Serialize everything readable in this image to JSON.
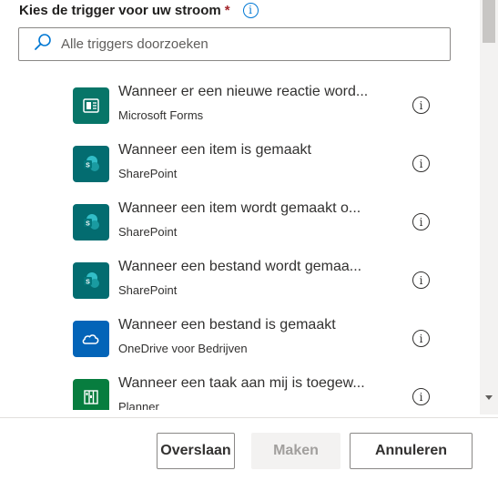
{
  "header": {
    "title": "Kies de trigger voor uw stroom",
    "required_mark": "*",
    "info_glyph": "i"
  },
  "search": {
    "placeholder": "Alle triggers doorzoeken"
  },
  "triggers": [
    {
      "title": "Wanneer er een nieuwe reactie word...",
      "connector": "Microsoft Forms",
      "icon": "forms-icon",
      "color": "#077568"
    },
    {
      "title": "Wanneer een item is gemaakt",
      "connector": "SharePoint",
      "icon": "sharepoint-icon",
      "color": "#036c70"
    },
    {
      "title": "Wanneer een item wordt gemaakt o...",
      "connector": "SharePoint",
      "icon": "sharepoint-icon",
      "color": "#036c70"
    },
    {
      "title": "Wanneer een bestand wordt gemaa...",
      "connector": "SharePoint",
      "icon": "sharepoint-icon",
      "color": "#036c70"
    },
    {
      "title": "Wanneer een bestand is gemaakt",
      "connector": "OneDrive voor Bedrijven",
      "icon": "onedrive-icon",
      "color": "#0364b8"
    },
    {
      "title": "Wanneer een taak aan mij is toegew...",
      "connector": "Planner",
      "icon": "planner-icon",
      "color": "#077d3f"
    }
  ],
  "buttons": {
    "skip": "Overslaan",
    "create": "Maken",
    "cancel": "Annuleren"
  },
  "colors": {
    "accent": "#0078d4",
    "required": "#a4262c"
  }
}
